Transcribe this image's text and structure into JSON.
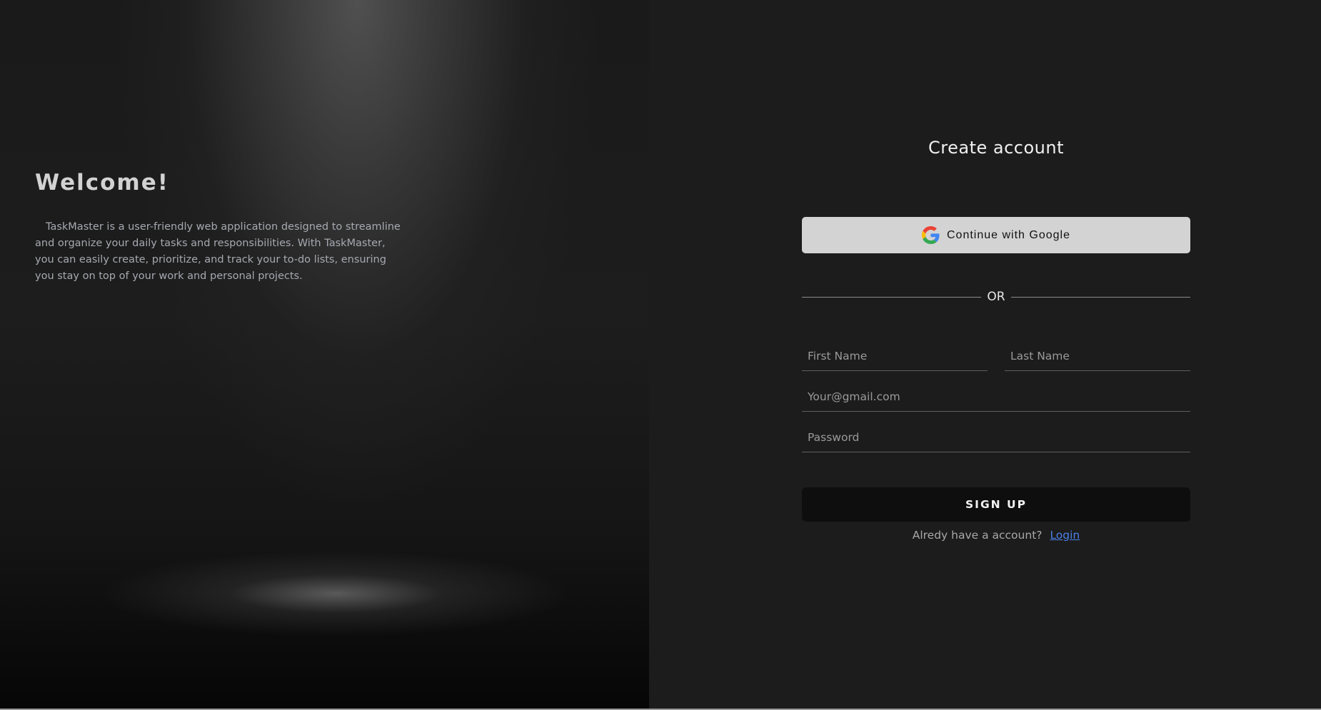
{
  "welcome": {
    "title": "Welcome!",
    "description": "TaskMaster is a user-friendly web application designed to streamline and organize your daily tasks and responsibilities. With TaskMaster, you can easily create, prioritize, and track your to-do lists, ensuring you stay on top of your work and personal projects."
  },
  "signup": {
    "title": "Create account",
    "google_button_label": "Continue with Google",
    "google_icon": "google-g-icon",
    "divider_text": "OR",
    "first_name_placeholder": "First Name",
    "last_name_placeholder": "Last Name",
    "email_placeholder": "Your@gmail.com",
    "password_placeholder": "Password",
    "submit_label": "SIGN UP",
    "login_prompt": "Alredy have a account?",
    "login_link": "Login"
  },
  "colors": {
    "background": "#1c1c1c",
    "google_button": "#d3d3d3",
    "signup_button": "#0e0e0e",
    "link": "#4a7fe6"
  }
}
